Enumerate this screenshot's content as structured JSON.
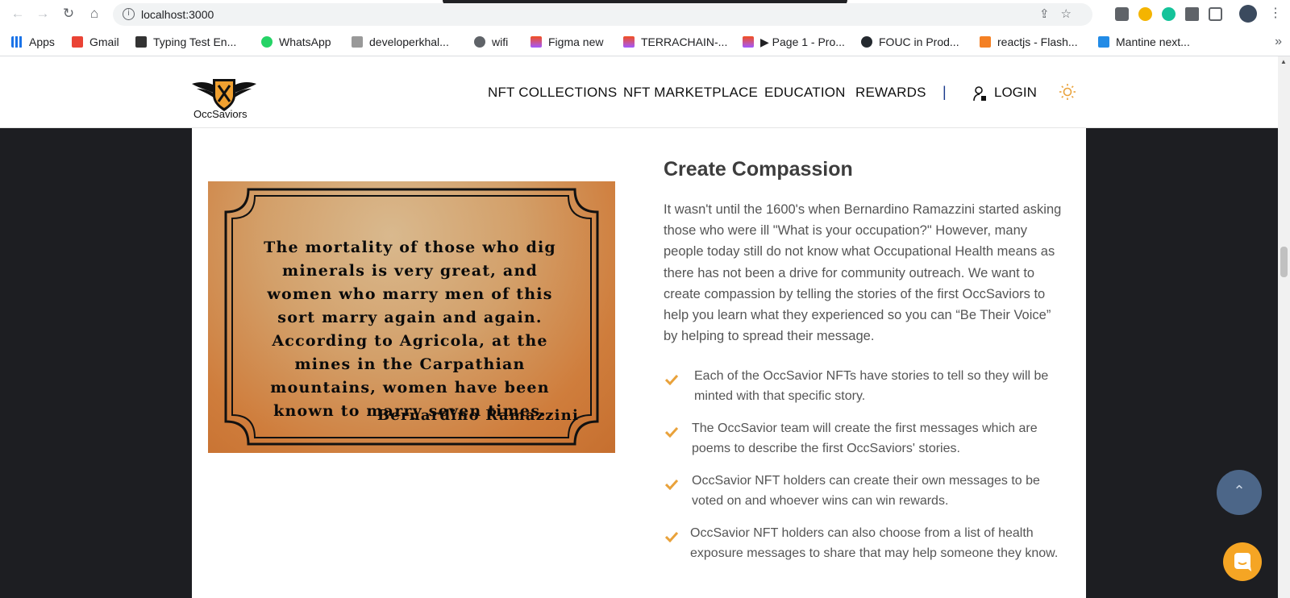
{
  "browser": {
    "url": "localhost:3000",
    "bookmarks": [
      {
        "label": "Apps",
        "color": "#1a73e8"
      },
      {
        "label": "Gmail",
        "color": "#ea4335"
      },
      {
        "label": "Typing Test En...",
        "color": "#333333"
      },
      {
        "label": "WhatsApp",
        "color": "#25d366"
      },
      {
        "label": "developerkhal...",
        "color": "#777777"
      },
      {
        "label": "wifi",
        "color": "#5f6368"
      },
      {
        "label": "Figma new",
        "color": "#f24e1e"
      },
      {
        "label": "TERRACHAIN-...",
        "color": "#f24e1e"
      },
      {
        "label": "▶ Page 1 - Pro...",
        "color": "#f24e1e"
      },
      {
        "label": "FOUC in Prod...",
        "color": "#24292f"
      },
      {
        "label": "reactjs - Flash...",
        "color": "#f48024"
      },
      {
        "label": "Mantine next...",
        "color": "#228be6"
      }
    ]
  },
  "header": {
    "logo_text": "OccSaviors",
    "menu": [
      "NFT COLLECTIONS",
      "NFT MARKETPLACE",
      "EDUCATION",
      "REWARDS"
    ],
    "separator": "|",
    "login": "LOGIN"
  },
  "quote": {
    "text": "The mortality of those who dig minerals is very great, and women who marry men of this sort marry again and again. According to Agricola, at the mines in the Carpathian mountains, women have been known to marry seven times.",
    "author": "Bernardino Ramazzini"
  },
  "section": {
    "title": "Create Compassion",
    "body": "It wasn't until the 1600's when Bernardino Ramazzini started asking those who were ill \"What is your occupation?\" However, many people today still do not know what Occupational Health means as there has not been a drive for community outreach. We want to create compassion by telling the stories of the first OccSaviors to help you learn what they experienced so you can “Be Their Voice” by helping to spread their message.",
    "features": [
      "Each of the OccSavior NFTs have stories to tell so they will be minted with that specific story.",
      "The OccSavior team will create the first messages which are poems to describe the first OccSaviors' stories.",
      "OccSavior NFT holders can create their own messages to be voted on and whoever wins can win rewards.",
      "OccSavior NFT holders can also choose from a list of health exposure messages to share that may help someone they know."
    ]
  },
  "colors": {
    "accent": "#e9a23b",
    "page_bg": "#1d1e22",
    "back_to_top": "#4c6688",
    "chat": "#f5a524"
  }
}
